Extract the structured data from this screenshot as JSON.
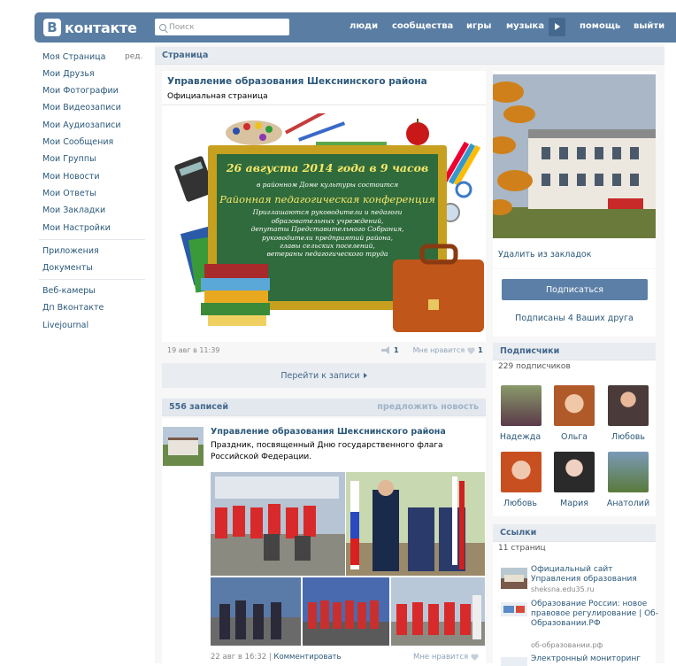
{
  "header": {
    "logo_letter": "В",
    "logo_text": "контакте",
    "search_placeholder": "Поиск",
    "nav": [
      "люди",
      "сообщества",
      "игры",
      "музыка",
      "помощь",
      "выйти"
    ]
  },
  "left_menu": {
    "edit_label": "ред.",
    "items": [
      "Моя Страница",
      "Мои Друзья",
      "Мои Фотографии",
      "Мои Видеозаписи",
      "Мои Аудиозаписи",
      "Мои Сообщения",
      "Мои Группы",
      "Мои Новости",
      "Мои Ответы",
      "Мои Закладки",
      "Мои Настройки"
    ],
    "apps": [
      "Приложения",
      "Документы"
    ],
    "extra": [
      "Веб-камеры",
      "Дп Вконтакте",
      "Livejournal"
    ]
  },
  "page": {
    "section_title": "Страница",
    "name": "Управление образования Шекснинского района",
    "subtitle": "Официальная страница"
  },
  "banner": {
    "line1": "26 августа 2014 года в 9 часов",
    "line2": "в районном Доме культуры состоится",
    "line3": "Районная педагогическая конференция",
    "line4": "Приглашаются руководители и педагоги",
    "line5": "образовательных учреждений,",
    "line6": "депутаты Представительного Собрания,",
    "line7": "руководители предприятий района,",
    "line8": "главы сельских поселений,",
    "line9": "ветераны педагогического труда"
  },
  "post1": {
    "date": "19 авг в 11:39",
    "shares": "1",
    "like_label": "Мне нравится",
    "likes": "1",
    "goto_label": "Перейти к записи"
  },
  "wall": {
    "count_label": "556 записей",
    "suggest_label": "предложить новость"
  },
  "post2": {
    "author": "Управление образования Шекснинского района",
    "text": "Праздник, посвященный Дню государственного флага Российской Федерации.",
    "date": "22 авг в 16:32",
    "comment_label": "Комментировать",
    "like_label": "Мне нравится",
    "sep": "|"
  },
  "right": {
    "remove_bookmark": "Удалить из закладок",
    "subscribe_button": "Подписаться",
    "subscribed_friends": "Подписаны 4 Ваших друга",
    "subscribers_title": "Подписчики",
    "subscribers_count": "229 подписчиков",
    "subscribers": [
      "Надежда",
      "Ольга",
      "Любовь",
      "Любовь",
      "Мария",
      "Анатолий"
    ],
    "links_title": "Ссылки",
    "links_count": "11 страниц",
    "links": [
      {
        "title": "Официальный сайт Управления образования",
        "url": "sheksna.edu35.ru"
      },
      {
        "title": "Образование России: новое правовое регулирование | Об-Образовании.РФ",
        "url": "об-образовании.рф"
      },
      {
        "title": "Электронный мониторинг",
        "url": ""
      }
    ]
  }
}
